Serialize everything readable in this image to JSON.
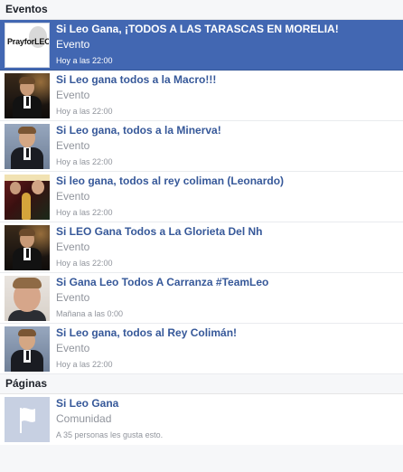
{
  "events_section": {
    "header": "Eventos",
    "items": [
      {
        "title": "Si Leo Gana, ¡TODOS A LAS TARASCAS EN MORELIA!",
        "type": "Evento",
        "time": "Hoy a las 22:00",
        "thumb_icon": "prayforleo-image",
        "thumb_text": "PrayforLEO",
        "selected": true
      },
      {
        "title": "Si Leo gana todos a la Macro!!!",
        "type": "Evento",
        "time": "Hoy a las 22:00",
        "thumb_icon": "leo-photo",
        "selected": false
      },
      {
        "title": "Si Leo gana, todos a la Minerva!",
        "type": "Evento",
        "time": "Hoy a las 22:00",
        "thumb_icon": "leo-photo",
        "selected": false
      },
      {
        "title": "Si leo gana, todos al rey coliman (Leonardo)",
        "type": "Evento",
        "time": "Hoy a las 22:00",
        "thumb_icon": "leo-poster-photo",
        "selected": false
      },
      {
        "title": "Si LEO Gana Todos a La Glorieta Del Nh",
        "type": "Evento",
        "time": "Hoy a las 22:00",
        "thumb_icon": "leo-photo",
        "selected": false
      },
      {
        "title": "Si Gana Leo Todos A Carranza #TeamLeo",
        "type": "Evento",
        "time": "Mañana a las 0:00",
        "thumb_icon": "leo-portrait-photo",
        "selected": false
      },
      {
        "title": "Si Leo gana, todos al Rey Colimán!",
        "type": "Evento",
        "time": "Hoy a las 22:00",
        "thumb_icon": "leo-photo",
        "selected": false
      }
    ]
  },
  "pages_section": {
    "header": "Páginas",
    "items": [
      {
        "title": "Si Leo Gana",
        "type": "Comunidad",
        "likes": "A 35 personas les gusta esto.",
        "thumb_icon": "flag-icon"
      }
    ]
  },
  "colors": {
    "selected_bg": "#4267b2",
    "link": "#365899",
    "muted": "#90949c",
    "header_bg": "#f6f7f9"
  }
}
